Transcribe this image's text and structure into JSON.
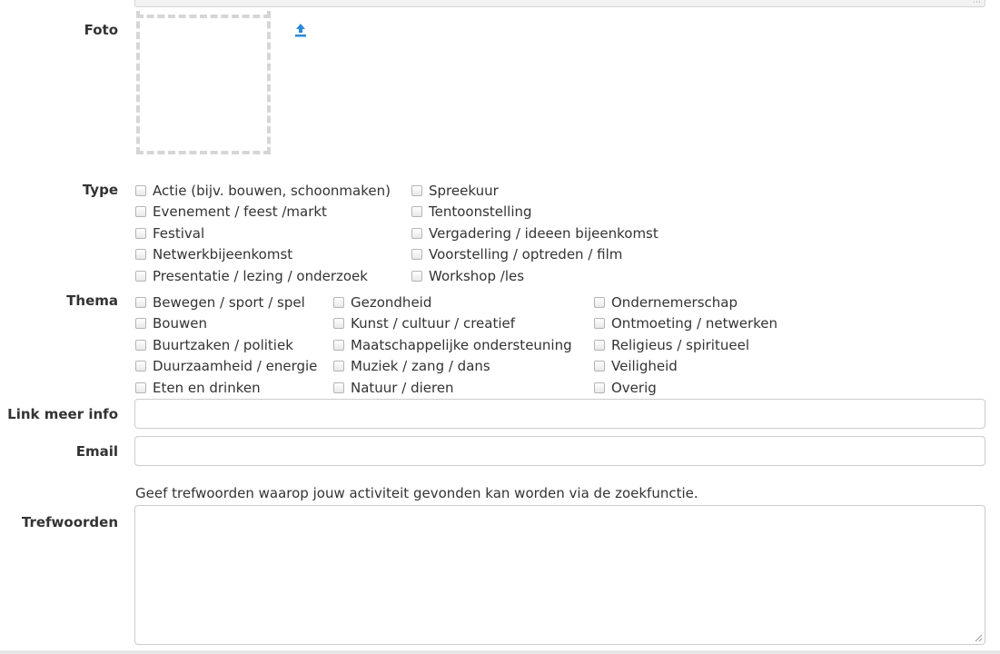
{
  "foto": {
    "label": "Foto",
    "upload_icon": "upload-icon"
  },
  "type": {
    "label": "Type",
    "col1": [
      "Actie (bijv. bouwen, schoonmaken)",
      "Evenement / feest /markt",
      "Festival",
      "Netwerkbijeenkomst",
      "Presentatie / lezing / onderzoek"
    ],
    "col2": [
      "Spreekuur",
      "Tentoonstelling",
      "Vergadering / ideeen bijeenkomst",
      "Voorstelling / optreden / film",
      "Workshop /les"
    ]
  },
  "thema": {
    "label": "Thema",
    "col1": [
      "Bewegen / sport / spel",
      "Bouwen",
      "Buurtzaken / politiek",
      "Duurzaamheid / energie",
      "Eten en drinken"
    ],
    "col2": [
      "Gezondheid",
      "Kunst / cultuur / creatief",
      "Maatschappelijke ondersteuning",
      "Muziek / zang / dans",
      "Natuur / dieren"
    ],
    "col3": [
      "Ondernemerschap",
      "Ontmoeting / netwerken",
      "Religieus / spiritueel",
      "Veiligheid",
      "Overig"
    ]
  },
  "link": {
    "label": "Link meer info",
    "value": ""
  },
  "email": {
    "label": "Email",
    "value": ""
  },
  "trefwoorden": {
    "hint": "Geef trefwoorden waarop jouw activiteit gevonden kan worden via de zoekfunctie.",
    "label": "Trefwoorden",
    "value": ""
  },
  "colors": {
    "accent": "#2a8ad8",
    "border": "#cccccc",
    "dashed": "#d6d6d6"
  }
}
